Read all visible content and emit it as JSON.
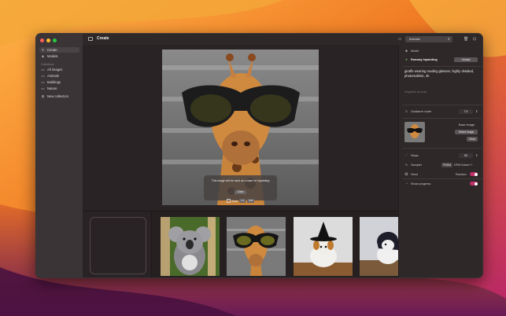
{
  "sidebar": {
    "items": [
      {
        "label": "Create",
        "icon": "sparkle-icon"
      },
      {
        "label": "Models",
        "icon": "cube-icon"
      }
    ],
    "collections_header": "Collections",
    "collections": [
      {
        "label": "All images",
        "icon": "folder-icon"
      },
      {
        "label": "Animals",
        "icon": "folder-icon"
      },
      {
        "label": "Buildings",
        "icon": "folder-icon"
      },
      {
        "label": "Nature",
        "icon": "folder-icon"
      }
    ],
    "new_collection": "New collection"
  },
  "toolbar": {
    "title": "Create",
    "collection_select": "Animals"
  },
  "canvas": {
    "notice": "This image will be used as a base for inpainting",
    "clear_label": "Clear",
    "mask_label": "Mask",
    "mask_opt1": "1.0",
    "mask_opt2": "Edit"
  },
  "panel": {
    "model_label": "Model",
    "model_name": "Runway Inpainting",
    "unload_label": "Unload",
    "prompt": "giraffe wearing reading glasses, highly detailed, photorealistic, 4k",
    "negative_placeholder": "Negative prompt",
    "guidance_label": "Guidance scale",
    "guidance_value": "7.5",
    "base_image_label": "Base image",
    "select_image_label": "Select image",
    "clear_label": "Clear",
    "steps_label": "Steps",
    "steps_value": "50",
    "sampler_label": "Sampler",
    "sampler_tag": "PNDM",
    "sampler_value": "DPM-Solver++",
    "seed_label": "Seed",
    "seed_value": "Random",
    "progress_label": "Show progress"
  },
  "gallery": [
    {
      "name": "koala"
    },
    {
      "name": "giraffe"
    },
    {
      "name": "dog-witch-hat"
    },
    {
      "name": "dog-hood"
    }
  ],
  "colors": {
    "accent": "#c0306a",
    "sidebar_bg": "#3a3437",
    "window_bg": "#2b2426"
  }
}
